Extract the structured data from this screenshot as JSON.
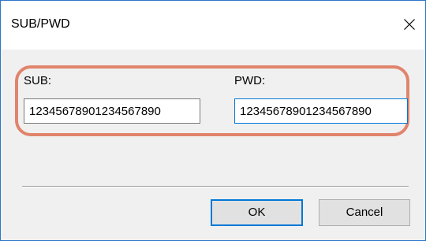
{
  "window": {
    "title": "SUB/PWD",
    "close_icon": "close-icon"
  },
  "form": {
    "sub_label": "SUB:",
    "sub_value": "12345678901234567890",
    "pwd_label": "PWD:",
    "pwd_value": "12345678901234567890"
  },
  "buttons": {
    "ok_label": "OK",
    "cancel_label": "Cancel"
  },
  "colors": {
    "highlight": "#e0846c",
    "focus_accent": "#0078d7",
    "window_border": "#2b76c8"
  }
}
